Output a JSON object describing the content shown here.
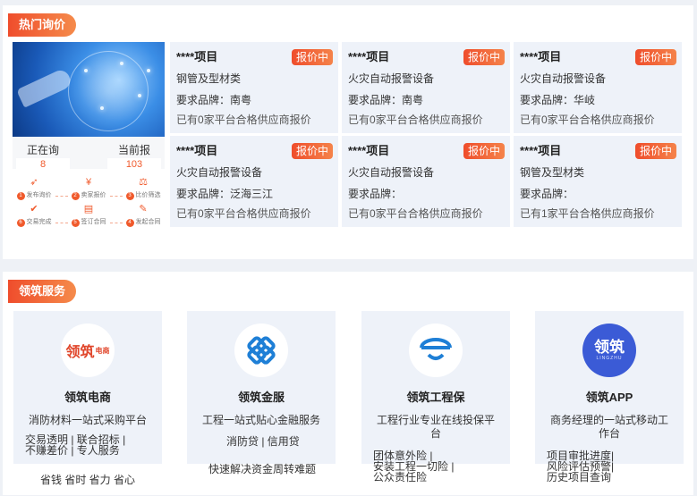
{
  "hot": {
    "badge": "热门询价",
    "promo": {
      "inquiring_label": "正在询",
      "inquiring_value": "8",
      "quoting_label": "当前报",
      "quoting_value": "103",
      "steps": [
        {
          "num": "1",
          "label": "发布询价",
          "icon": "paper-plane-icon"
        },
        {
          "num": "2",
          "label": "卖家报价",
          "icon": "price-icon"
        },
        {
          "num": "3",
          "label": "比价筛选",
          "icon": "compare-icon"
        },
        {
          "num": "6",
          "label": "交易完成",
          "icon": "check-circle-icon"
        },
        {
          "num": "5",
          "label": "签订合同",
          "icon": "document-icon"
        },
        {
          "num": "4",
          "label": "发起合同",
          "icon": "contract-icon"
        }
      ]
    },
    "tag_label": "报价中",
    "cards": [
      {
        "title": "****项目",
        "material": "钢管及型材类",
        "brand": "要求品牌：南粤",
        "quotes": "已有0家平台合格供应商报价"
      },
      {
        "title": "****项目",
        "material": "火灾自动报警设备",
        "brand": "要求品牌：南粤",
        "quotes": "已有0家平台合格供应商报价"
      },
      {
        "title": "****项目",
        "material": "火灾自动报警设备",
        "brand": "要求品牌：华岐",
        "quotes": "已有0家平台合格供应商报价"
      },
      {
        "title": "****项目",
        "material": "火灾自动报警设备",
        "brand": "要求品牌：泛海三江",
        "quotes": "已有0家平台合格供应商报价"
      },
      {
        "title": "****项目",
        "material": "火灾自动报警设备",
        "brand": "要求品牌：",
        "quotes": "已有0家平台合格供应商报价"
      },
      {
        "title": "****项目",
        "material": "钢管及型材类",
        "brand": "要求品牌：",
        "quotes": "已有1家平台合格供应商报价"
      }
    ]
  },
  "services": {
    "badge": "领筑服务",
    "items": [
      {
        "logo_text": "领筑",
        "logo_sub": "电商",
        "name": "领筑电商",
        "desc": "消防材料一站式采购平台",
        "extra": [
          "交易透明 | 联合招标 |",
          "不赚差价 | 专人服务"
        ],
        "below": "省钱 省时 省力 省心"
      },
      {
        "name": "领筑金服",
        "desc": "工程一站式贴心金融服务",
        "extra": [
          "消防贷 | 信用贷"
        ],
        "below": "快速解决资金周转难题"
      },
      {
        "name": "领筑工程保",
        "desc": "工程行业专业在线投保平台",
        "extra": [
          "团体意外险 |",
          "安装工程一切险 |",
          "公众责任险"
        ]
      },
      {
        "logo_text": "领筑",
        "logo_sub": "LINGZHU",
        "name": "领筑APP",
        "desc": "商务经理的一站式移动工作台",
        "extra": [
          "项目审批进度|",
          "风险评估预警|",
          "历史项目查询"
        ]
      }
    ]
  },
  "colors": {
    "accent": "#ef4d2c",
    "card_bg": "#eef2f9",
    "jinfu_blue": "#1e7fd6",
    "app_blue": "#3b5bd6"
  }
}
